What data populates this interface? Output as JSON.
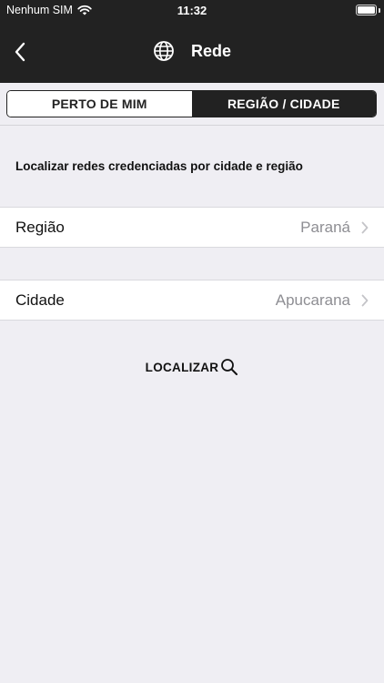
{
  "status_bar": {
    "carrier": "Nenhum SIM",
    "time": "11:32"
  },
  "nav": {
    "title": "Rede"
  },
  "segments": {
    "near_me": "PERTO DE MIM",
    "region_city": "REGIÃO / CIDADE",
    "selected": "region_city"
  },
  "content": {
    "description": "Localizar redes credenciadas por cidade e região",
    "region": {
      "label": "Região",
      "value": "Paraná"
    },
    "city": {
      "label": "Cidade",
      "value": "Apucarana"
    },
    "search_label": "LOCALIZAR"
  },
  "icons": [
    "back-chevron-icon",
    "globe-icon",
    "wifi-icon",
    "battery-icon",
    "chevron-right-icon",
    "search-icon"
  ],
  "colors": {
    "header": "#222222",
    "background": "#efeef3",
    "secondary_text": "#8e8e93"
  }
}
